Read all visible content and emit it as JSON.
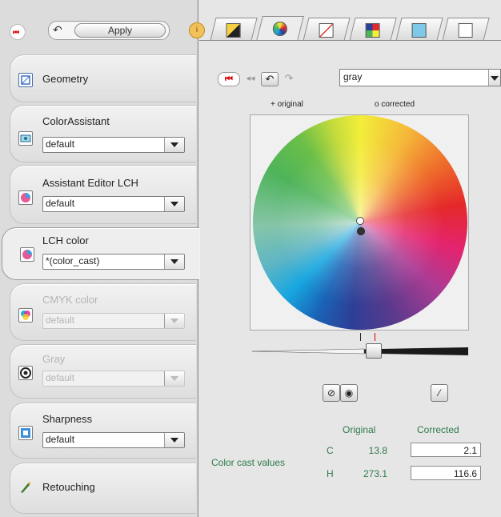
{
  "toolbar": {
    "apply_label": "Apply"
  },
  "modules": [
    {
      "title": "Geometry",
      "icon": "geometry-icon"
    },
    {
      "title": "ColorAssistant",
      "value": "default",
      "icon": "color-assistant-icon"
    },
    {
      "title": "Assistant Editor LCH",
      "value": "default",
      "icon": "assistant-editor-lch-icon"
    },
    {
      "title": "LCH color",
      "value": "*(color_cast)",
      "icon": "lch-color-icon",
      "active": true
    },
    {
      "title": "CMYK color",
      "value": "default",
      "icon": "cmyk-color-icon",
      "disabled": true
    },
    {
      "title": "Gray",
      "value": "default",
      "icon": "gray-icon",
      "disabled": true
    },
    {
      "title": "Sharpness",
      "value": "default",
      "icon": "sharpness-icon"
    },
    {
      "title": "Retouching",
      "icon": "retouching-icon"
    }
  ],
  "tabs": [
    "gradation-tab-icon",
    "color-wheel-tab-icon",
    "curve-tab-icon",
    "palette-tab-icon",
    "channel-tab-icon",
    "preview-tab-icon"
  ],
  "preset": {
    "value": "gray"
  },
  "legend": {
    "original": "+ original",
    "corrected": "o corrected"
  },
  "wheel": {
    "original_position": {
      "c": 13.8,
      "h": 273.1
    },
    "corrected_position": {
      "c": 2.1,
      "h": 116.6
    }
  },
  "colorcast": {
    "section_label": "Color cast values",
    "header_original": "Original",
    "header_corrected": "Corrected",
    "rows": [
      {
        "label": "C",
        "original": "13.8",
        "corrected": "2.1"
      },
      {
        "label": "H",
        "original": "273.1",
        "corrected": "116.6"
      }
    ]
  },
  "colors": {
    "accent_green": "#2e7a4a",
    "reset_red": "#dd0000"
  }
}
